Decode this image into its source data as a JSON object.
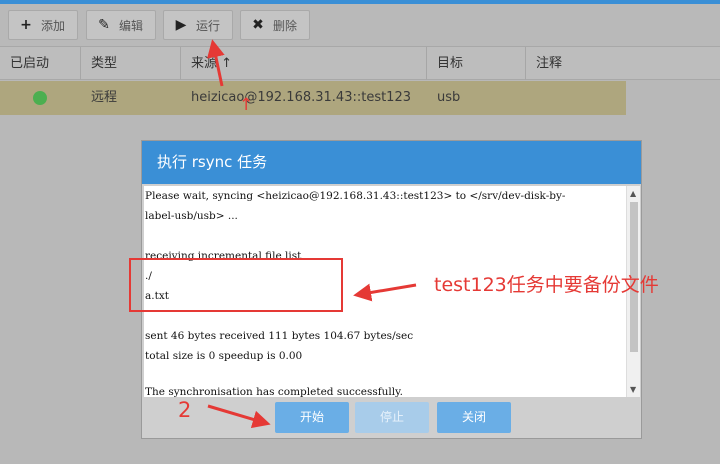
{
  "toolbar": {
    "add": "添加",
    "edit": "编辑",
    "run": "运行",
    "delete": "删除"
  },
  "grid": {
    "columns": [
      "已启动",
      "类型",
      "来源",
      "目标",
      "注释"
    ],
    "sort_indicator": "↑",
    "rows": [
      {
        "enabled": true,
        "type": "远程",
        "source": "heizicao@192.168.31.43::test123",
        "target": "usb",
        "comment": ""
      }
    ]
  },
  "dialog": {
    "title": "执行 rsync 任务",
    "console_lines": [
      "Please wait, syncing <heizicao@192.168.31.43::test123> to </srv/dev-disk-by-",
      "label-usb/usb> ...",
      "",
      "receiving incremental file list",
      "./",
      "a.txt",
      "",
      "sent 46 bytes  received 111 bytes  104.67 bytes/sec",
      "total size is 0  speedup is 0.00",
      "",
      "The synchronisation has completed successfully."
    ],
    "buttons": {
      "start": "开始",
      "stop": "停止",
      "close": "关闭"
    }
  },
  "annotations": {
    "main_text": "test123任务中要备份文件",
    "step_number": "2",
    "up_arrow": "↑"
  },
  "colors": {
    "accent": "#3a8fd6",
    "status_green": "#4caf50",
    "annotation_red": "#e53935"
  }
}
